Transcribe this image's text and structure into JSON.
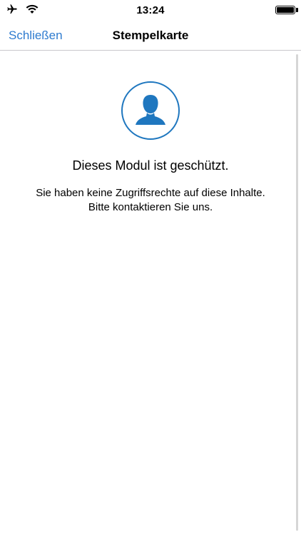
{
  "status_bar": {
    "time": "13:24",
    "icons": [
      "airplane-icon",
      "wifi-icon",
      "battery-icon"
    ]
  },
  "nav": {
    "close_label": "Schließen",
    "title": "Stempelkarte"
  },
  "protected": {
    "icon": "user-silhouette-icon",
    "heading": "Dieses Modul ist geschützt.",
    "message_line1": "Sie haben keine Zugriffsrechte auf diese Inhalte.",
    "message_line2": "Bitte kontaktieren Sie uns."
  },
  "colors": {
    "accent": "#2e7bcf",
    "icon_blue": "#1f77bf",
    "divider": "#c8c7cc"
  }
}
